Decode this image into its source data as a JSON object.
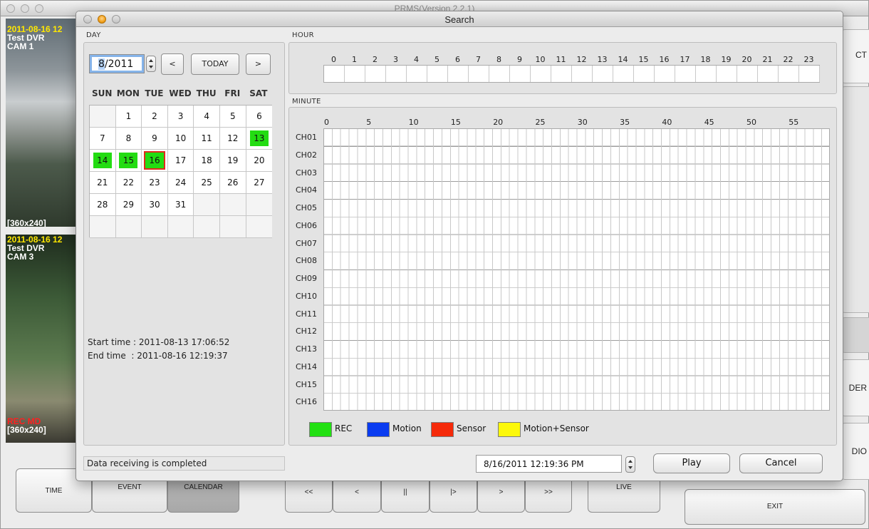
{
  "app": {
    "title": "PRMS(Version 2.2.1)",
    "cam1": {
      "date": "2011-08-16 12",
      "dvr": "Test DVR",
      "cam": "CAM 1",
      "resolution": "[360x240]"
    },
    "cam3": {
      "date": "2011-08-16 12",
      "dvr": "Test DVR",
      "cam": "CAM 3",
      "status": "REC  MD",
      "resolution": "[360x240]"
    },
    "right_buttons": {
      "select": "CT",
      "recorder": "DER",
      "audio": "DIO"
    },
    "bottom_buttons": {
      "time": "TIME",
      "event": "EVENT",
      "calendar": "CALENDAR",
      "rewind": "<<",
      "prev": "<",
      "pause": "||",
      "play": "|>",
      "next": ">",
      "fast_forward": ">>",
      "live": "LIVE",
      "exit": "EXIT"
    }
  },
  "dialog": {
    "title": "Search",
    "day_section": {
      "label": "DAY",
      "month_field": {
        "month": "8",
        "year": "/2011"
      },
      "prev_label": "<",
      "today_label": "TODAY",
      "next_label": ">",
      "weekdays": [
        "SUN",
        "MON",
        "TUE",
        "WED",
        "THU",
        "FRI",
        "SAT"
      ],
      "weeks": [
        [
          "",
          "1",
          "2",
          "3",
          "4",
          "5",
          "6"
        ],
        [
          "7",
          "8",
          "9",
          "10",
          "11",
          "12",
          "13"
        ],
        [
          "14",
          "15",
          "16",
          "17",
          "18",
          "19",
          "20"
        ],
        [
          "21",
          "22",
          "23",
          "24",
          "25",
          "26",
          "27"
        ],
        [
          "28",
          "29",
          "30",
          "31",
          "",
          "",
          ""
        ],
        [
          "",
          "",
          "",
          "",
          "",
          "",
          ""
        ]
      ],
      "recorded_days": [
        "13",
        "14",
        "15",
        "16"
      ],
      "selected_day": "16",
      "start_time": "Start time : 2011-08-13 17:06:52",
      "end_time": "End time  : 2011-08-16 12:19:37"
    },
    "hour_section": {
      "label": "HOUR",
      "hours": [
        "0",
        "1",
        "2",
        "3",
        "4",
        "5",
        "6",
        "7",
        "8",
        "9",
        "10",
        "11",
        "12",
        "13",
        "14",
        "15",
        "16",
        "17",
        "18",
        "19",
        "20",
        "21",
        "22",
        "23"
      ]
    },
    "minute_section": {
      "label": "MINUTE",
      "minute_ticks": [
        "0",
        "5",
        "10",
        "15",
        "20",
        "25",
        "30",
        "35",
        "40",
        "45",
        "50",
        "55"
      ],
      "channels": [
        "CH01",
        "CH02",
        "CH03",
        "CH04",
        "CH05",
        "CH06",
        "CH07",
        "CH08",
        "CH09",
        "CH10",
        "CH11",
        "CH12",
        "CH13",
        "CH14",
        "CH15",
        "CH16"
      ]
    },
    "legend": [
      {
        "label": "REC",
        "color": "#22e012"
      },
      {
        "label": "Motion",
        "color": "#0a3cf0"
      },
      {
        "label": "Sensor",
        "color": "#f52a0a"
      },
      {
        "label": "Motion+Sensor",
        "color": "#fcf80a"
      }
    ],
    "status": "Data receiving is completed",
    "datetime": "8/16/2011 12:19:36 PM",
    "play_label": "Play",
    "cancel_label": "Cancel"
  }
}
